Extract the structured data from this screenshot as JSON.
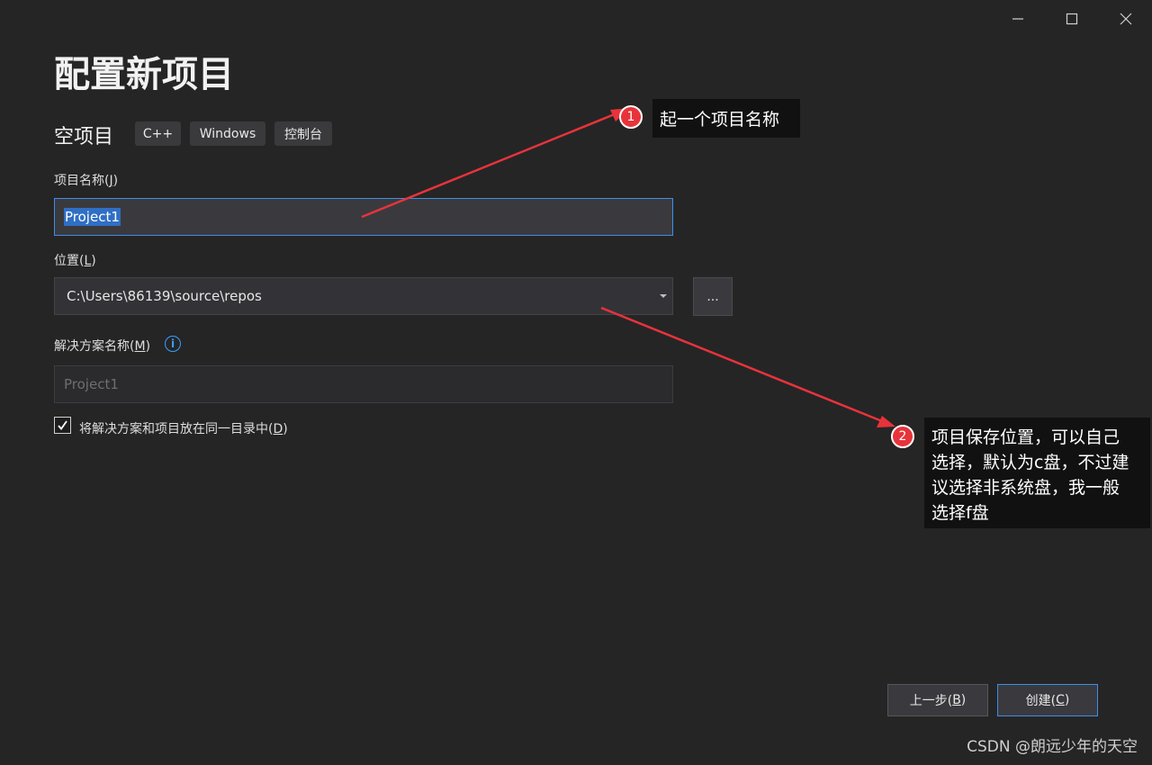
{
  "window": {
    "minimize_icon": "minimize-icon",
    "maximize_icon": "maximize-icon",
    "close_icon": "close-icon"
  },
  "page_title": "配置新项目",
  "template": {
    "name": "空项目",
    "tags": [
      "C++",
      "Windows",
      "控制台"
    ]
  },
  "project_name": {
    "label_prefix": "项目名称(",
    "label_key": "J",
    "label_suffix": ")",
    "value": "Project1"
  },
  "location": {
    "label_prefix": "位置(",
    "label_key": "L",
    "label_suffix": ")",
    "value": "C:\\Users\\86139\\source\\repos",
    "browse_label": "..."
  },
  "solution_name": {
    "label_prefix": "解决方案名称(",
    "label_key": "M",
    "label_suffix": ")",
    "placeholder": "Project1",
    "info_icon": "info-icon"
  },
  "same_dir_checkbox": {
    "checked": true,
    "label_prefix": "将解决方案和项目放在同一目录中(",
    "label_key": "D",
    "label_suffix": ")"
  },
  "buttons": {
    "back": {
      "prefix": "上一步(",
      "key": "B",
      "suffix": ")"
    },
    "create": {
      "prefix": "创建(",
      "key": "C",
      "suffix": ")"
    }
  },
  "annotations": [
    {
      "number": "1",
      "text": "起一个项目名称"
    },
    {
      "number": "2",
      "lines": [
        "项目保存位置，可以自己",
        "选择，默认为c盘，不过建",
        "议选择非系统盘，我一般",
        "选择f盘"
      ]
    }
  ],
  "watermark": "CSDN @朗远少年的天空",
  "colors": {
    "background": "#252526",
    "accent": "#3d8ee8",
    "annotation_red": "#e8333a"
  }
}
